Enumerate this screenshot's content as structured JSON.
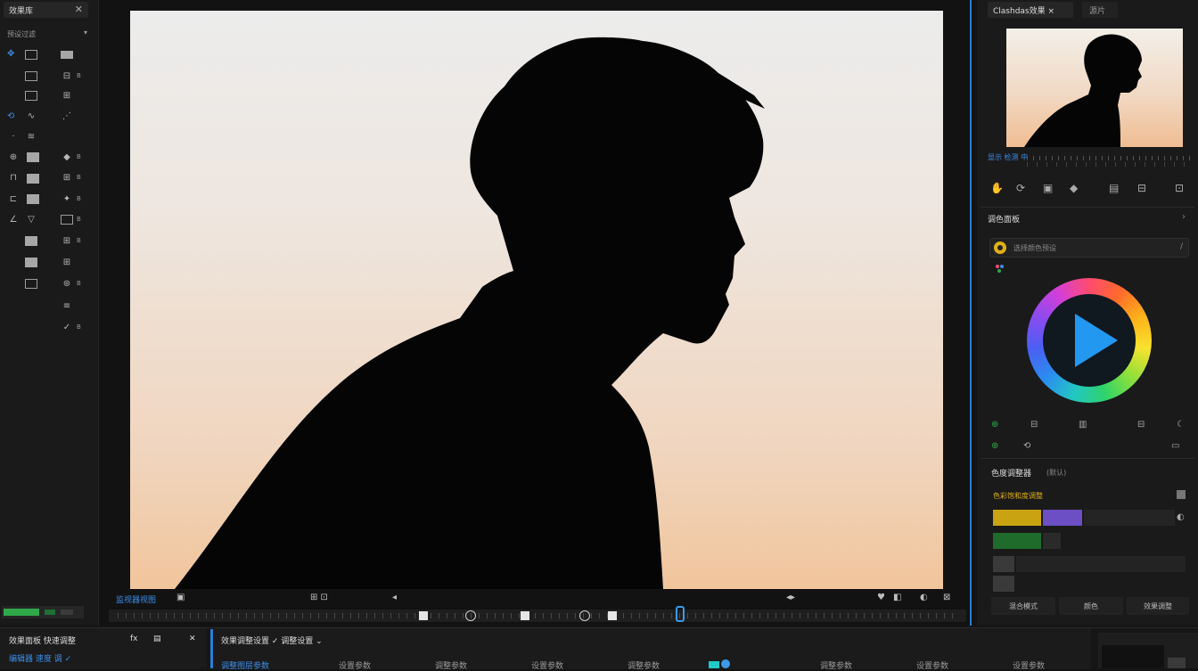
{
  "left_panel": {
    "header_title": "效果库",
    "header_close": "✕",
    "section_title": "预设过滤",
    "section_chevron": "▾",
    "tools": [
      {
        "icon": "move-icon",
        "label": ""
      },
      {
        "icon": "rect-icon",
        "label": ""
      },
      {
        "icon": "film-icon",
        "label": ""
      },
      {
        "icon": "grid-icon",
        "label": "B"
      },
      {
        "icon": "square-icon",
        "label": ""
      },
      {
        "icon": "layers-icon",
        "label": ""
      },
      {
        "icon": "transform-icon",
        "label": ""
      },
      {
        "icon": "wave-icon",
        "label": ""
      },
      {
        "icon": "pen-icon",
        "label": ""
      },
      {
        "icon": "text-icon",
        "label": ""
      },
      {
        "icon": "brush-icon",
        "label": ""
      },
      {
        "icon": "cloud-icon",
        "label": "B"
      },
      {
        "icon": "eraser-icon",
        "label": ""
      },
      {
        "icon": "mask-icon",
        "label": "B"
      },
      {
        "icon": "copy-icon",
        "label": ""
      },
      {
        "icon": "node-icon",
        "label": "B"
      },
      {
        "icon": "gradient-icon",
        "label": ""
      },
      {
        "icon": "frame-icon",
        "label": "B"
      },
      {
        "icon": "camera-icon",
        "label": ""
      },
      {
        "icon": "film-stack-icon",
        "label": "B"
      },
      {
        "icon": "grid-small-icon",
        "label": ""
      },
      {
        "icon": "tree-icon",
        "label": ""
      },
      {
        "icon": "chart-icon",
        "label": ""
      },
      {
        "icon": "effects-icon",
        "label": "B"
      },
      {
        "icon": "table-icon",
        "label": ""
      },
      {
        "icon": "wand-icon",
        "label": "B"
      }
    ]
  },
  "viewer": {
    "label": "监视器视图",
    "controls": [
      "▣",
      "⊞ ⊡",
      "◂",
      "◂▸",
      "♥",
      "◧",
      "◐",
      "⊠"
    ]
  },
  "right_panel": {
    "tab_active": "Clashdas效果 ×",
    "tab_other": "源片",
    "meta_label": "显示 检测 中",
    "section_title": "调色面板",
    "section_chevron": "›",
    "input_text": "选择颜色预设",
    "input_chevron": "/",
    "sub_title": "色度调整器",
    "sub_title2": "(默认)",
    "sub_line": "色彩饱和度调整",
    "buttons": [
      "混合模式",
      "颜色",
      "效果调整"
    ],
    "colors": {
      "yellow": "#c9a312",
      "purple": "#6c4fc4",
      "green": "#1f6b2b",
      "accent": "#2b7fd6"
    }
  },
  "bottom": {
    "left_title": "效果面板 快速调整",
    "left_sub": "编辑器 速度 调 ✓",
    "icons": [
      "fx",
      "▤",
      "✕"
    ],
    "track_title": "效果调整设置  ✓ 调整设置 ⌄",
    "track_sub": "调整图层参数",
    "items": [
      "设置参数",
      "调整参数",
      "设置参数",
      "调整参数",
      "调整参数",
      "设置参数",
      "设置参数",
      "调整参数"
    ]
  }
}
